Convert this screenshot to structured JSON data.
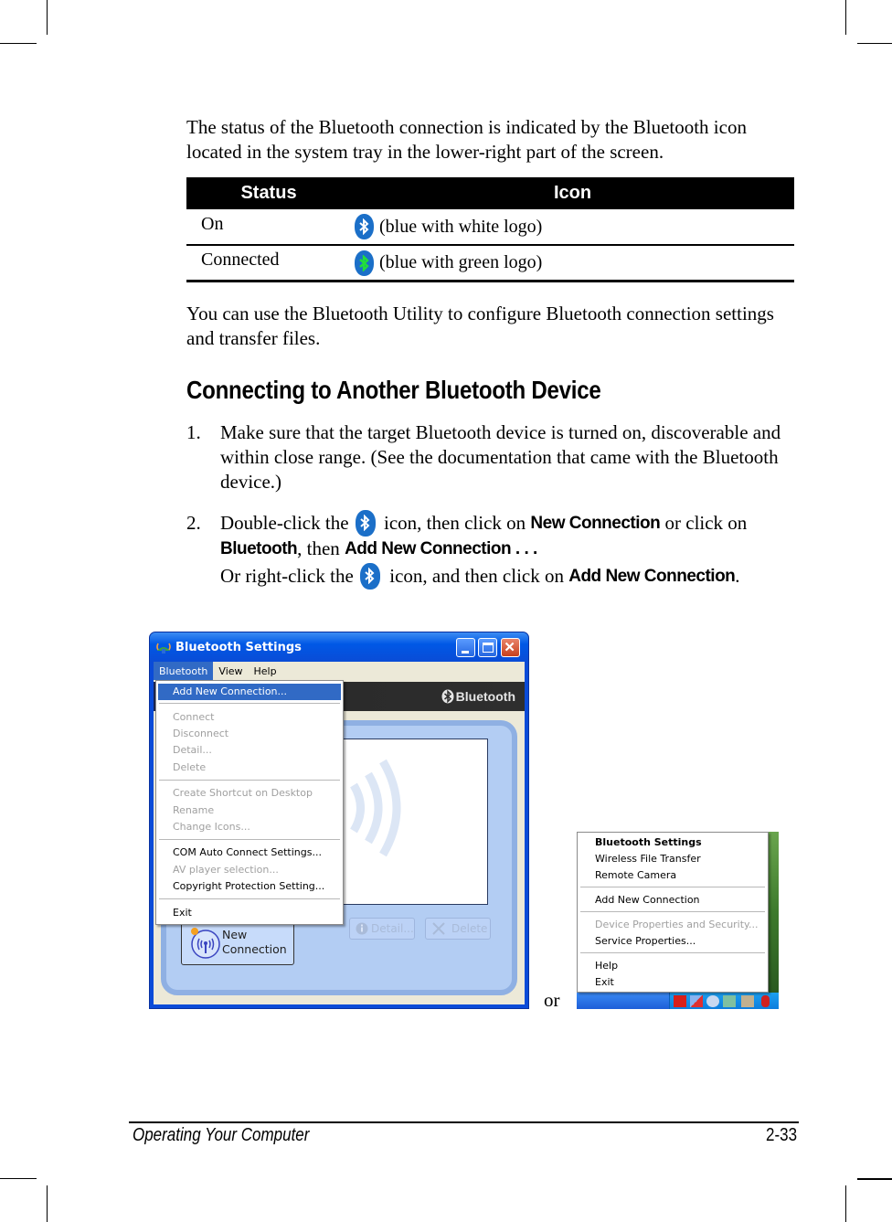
{
  "intro_text": "The status of the Bluetooth connection is indicated by the Bluetooth icon located in the system tray in the lower-right part of the screen.",
  "status_table": {
    "headers": [
      "Status",
      "Icon"
    ],
    "rows": [
      {
        "status": "On",
        "icon": "bluetooth-icon-white-logo",
        "description": "(blue with white logo)",
        "logo_color": "#ffffff"
      },
      {
        "status": "Connected",
        "icon": "bluetooth-icon-green-logo",
        "description": "(blue with green logo)",
        "logo_color": "#22e03a"
      }
    ]
  },
  "paragraph2": "You can use the Bluetooth Utility to configure Bluetooth connection settings and transfer files.",
  "section_heading": "Connecting to Another Bluetooth Device",
  "steps": [
    {
      "number": "1.",
      "text": "Make sure that the target Bluetooth device is turned on, discoverable and within close range. (See the documentation that came with the Bluetooth device.)"
    },
    {
      "number": "2.",
      "line1": {
        "pre": "Double-click the ",
        "post": " icon, then click on ",
        "bold1": "New Connection",
        "tail": " or click on"
      },
      "line2": {
        "bold1": "Bluetooth",
        "mid": ", then ",
        "bold2": "Add New Connection . . ."
      },
      "line3": {
        "pre": "Or right-click the ",
        "post": " icon, and then click on ",
        "bold1": "Add New Connection",
        "tail": "."
      }
    }
  ],
  "settings_window": {
    "title": "Bluetooth Settings",
    "menubar": [
      "Bluetooth",
      "View",
      "Help"
    ],
    "banner_logo": "Bluetooth",
    "menu_items": [
      {
        "label": "Add New Connection...",
        "state": "selected"
      },
      {
        "label": "Connect",
        "state": "disabled"
      },
      {
        "label": "Disconnect",
        "state": "disabled"
      },
      {
        "label": "Detail...",
        "state": "disabled"
      },
      {
        "label": "Delete",
        "state": "disabled"
      },
      {
        "label": "Create Shortcut on Desktop",
        "state": "disabled"
      },
      {
        "label": "Rename",
        "state": "disabled"
      },
      {
        "label": "Change Icons...",
        "state": "disabled"
      },
      {
        "label": "COM Auto Connect Settings...",
        "state": "enabled"
      },
      {
        "label": "AV player selection...",
        "state": "disabled"
      },
      {
        "label": "Copyright Protection Setting...",
        "state": "enabled"
      },
      {
        "label": "Exit",
        "state": "enabled"
      }
    ],
    "buttons": {
      "new_connection_line1": "New",
      "new_connection_line2": "Connection",
      "detail": "Detail...",
      "delete": "Delete"
    }
  },
  "or_text": "or",
  "tray_menu": {
    "items": [
      {
        "label": "Bluetooth Settings",
        "state": "bold"
      },
      {
        "label": "Wireless File Transfer",
        "state": "enabled"
      },
      {
        "label": "Remote Camera",
        "state": "enabled"
      },
      {
        "label": "Add New Connection",
        "state": "enabled"
      },
      {
        "label": "Device Properties and Security...",
        "state": "disabled"
      },
      {
        "label": "Service Properties...",
        "state": "enabled"
      },
      {
        "label": "Help",
        "state": "enabled"
      },
      {
        "label": "Exit",
        "state": "enabled"
      }
    ]
  },
  "footer": {
    "section": "Operating Your Computer",
    "page": "2-33"
  },
  "colors": {
    "bluetooth_blue": "#1b6fc8",
    "xp_title_blue": "#0058e6",
    "menu_highlight": "#316ac5"
  }
}
